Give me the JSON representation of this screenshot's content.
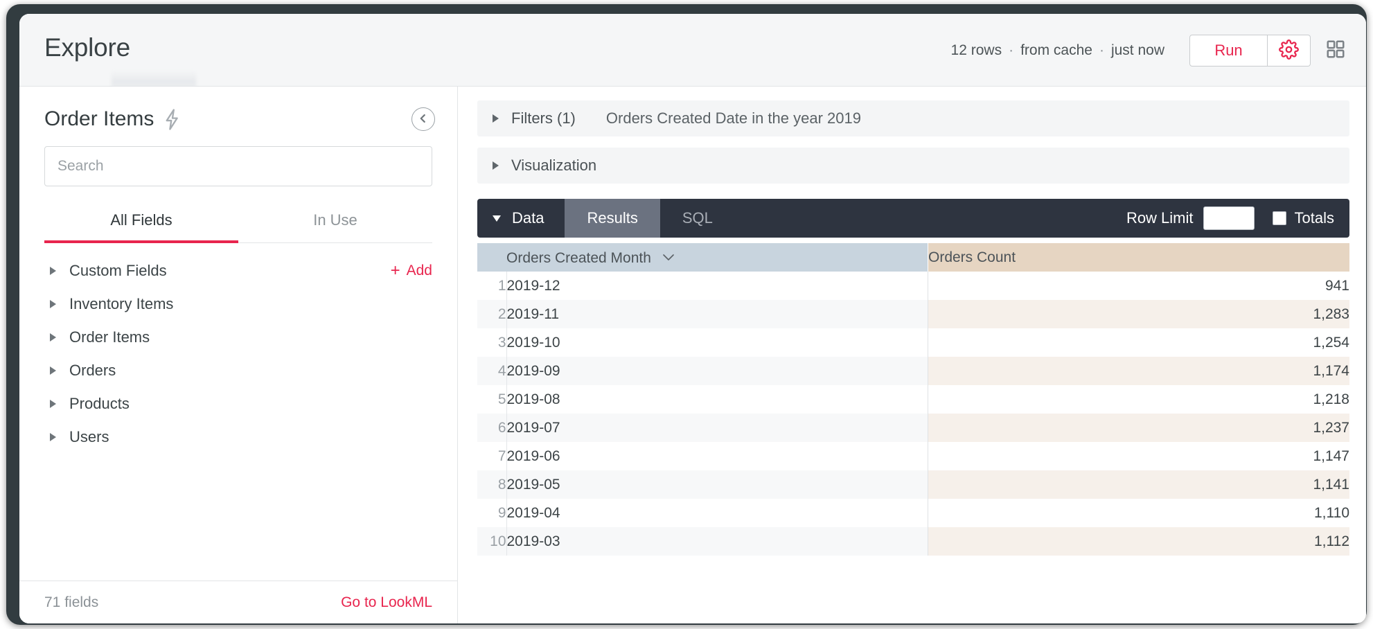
{
  "header": {
    "title": "Explore",
    "status": {
      "rows": "12 rows",
      "separator": "·",
      "cache": "from cache",
      "time": "just now"
    },
    "run_label": "Run",
    "settings_icon": "gear-icon",
    "grid_icon": "grid-icon"
  },
  "sidebar": {
    "explore_name": "Order Items",
    "lightning_icon": "lightning-bolt-icon",
    "collapse_icon": "chevron-left-circle-icon",
    "search_placeholder": "Search",
    "search_value": "",
    "tabs": [
      {
        "label": "All Fields",
        "active": true
      },
      {
        "label": "In Use",
        "active": false
      }
    ],
    "add_label": "Add",
    "add_plus": "+",
    "tree": [
      {
        "label": "Custom Fields",
        "has_add": true
      },
      {
        "label": "Inventory Items",
        "has_add": false
      },
      {
        "label": "Order Items",
        "has_add": false
      },
      {
        "label": "Orders",
        "has_add": false
      },
      {
        "label": "Products",
        "has_add": false
      },
      {
        "label": "Users",
        "has_add": false
      }
    ],
    "footer": {
      "field_count": "71 fields",
      "lookml_link": "Go to LookML"
    }
  },
  "main": {
    "filters_bar": {
      "label": "Filters (1)",
      "detail": "Orders Created Date in the year 2019"
    },
    "visualization_bar": {
      "label": "Visualization"
    },
    "data_strip": {
      "data_label": "Data",
      "tabs": [
        {
          "label": "Results",
          "active": true
        },
        {
          "label": "SQL",
          "active": false
        }
      ],
      "row_limit_label": "Row Limit",
      "row_limit_value": "",
      "totals_label": "Totals",
      "totals_checked": false
    }
  },
  "chart_data": {
    "type": "table",
    "title": "Orders Created Month by Orders Count",
    "columns": [
      {
        "name": "Orders Created Month",
        "type": "dimension",
        "sorted": true,
        "sort_icon": "chevron-down-icon"
      },
      {
        "name": "Orders Count",
        "type": "measure",
        "sorted": false
      }
    ],
    "categories": [
      "2019-12",
      "2019-11",
      "2019-10",
      "2019-09",
      "2019-08",
      "2019-07",
      "2019-06",
      "2019-05",
      "2019-04",
      "2019-03"
    ],
    "values": [
      941,
      1283,
      1254,
      1174,
      1218,
      1237,
      1147,
      1141,
      1110,
      1112
    ],
    "rows": [
      {
        "index": "1",
        "month": "2019-12",
        "count": "941"
      },
      {
        "index": "2",
        "month": "2019-11",
        "count": "1,283"
      },
      {
        "index": "3",
        "month": "2019-10",
        "count": "1,254"
      },
      {
        "index": "4",
        "month": "2019-09",
        "count": "1,174"
      },
      {
        "index": "5",
        "month": "2019-08",
        "count": "1,218"
      },
      {
        "index": "6",
        "month": "2019-07",
        "count": "1,237"
      },
      {
        "index": "7",
        "month": "2019-06",
        "count": "1,147"
      },
      {
        "index": "8",
        "month": "2019-05",
        "count": "1,141"
      },
      {
        "index": "9",
        "month": "2019-04",
        "count": "1,110"
      },
      {
        "index": "10",
        "month": "2019-03",
        "count": "1,112"
      }
    ]
  },
  "colors": {
    "accent": "#e8254e",
    "dark_strip": "#2e3440",
    "dimension_header": "#c8d4de",
    "measure_header": "#e6d5c2",
    "measure_row_alt": "#f6f0ea",
    "frame": "#323c40"
  }
}
